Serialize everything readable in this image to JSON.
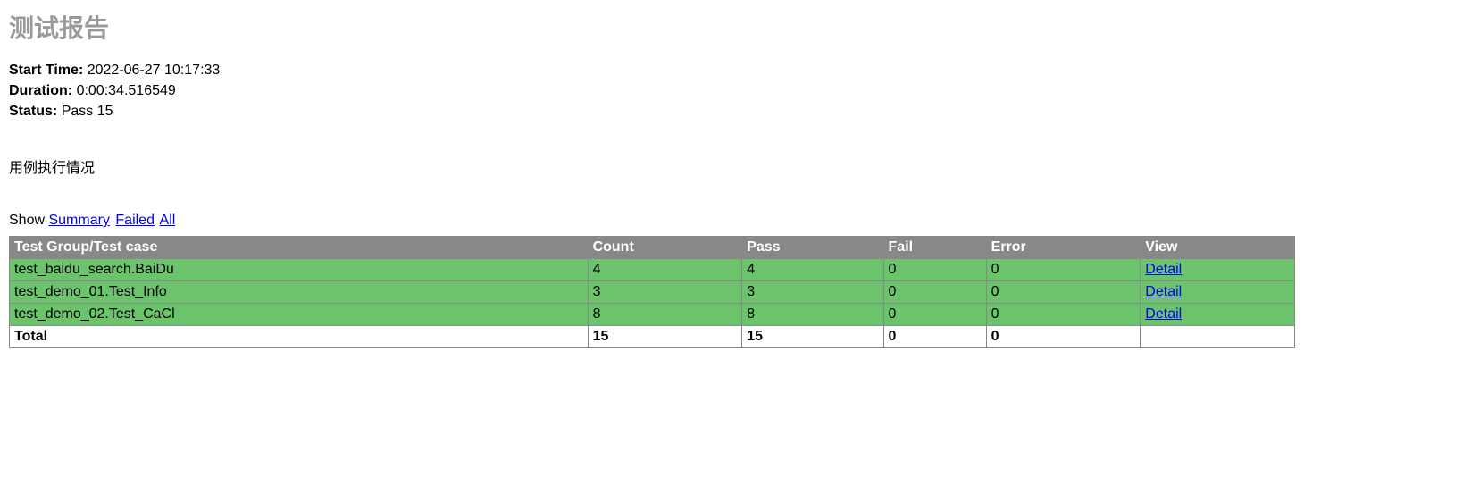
{
  "title": "测试报告",
  "info": {
    "start_time_label": "Start Time:",
    "start_time_value": "2022-06-27 10:17:33",
    "duration_label": "Duration:",
    "duration_value": "0:00:34.516549",
    "status_label": "Status:",
    "status_value": "Pass 15"
  },
  "section_title": "用例执行情况",
  "show": {
    "label": "Show",
    "summary": "Summary",
    "failed": "Failed",
    "all": "All"
  },
  "table": {
    "headers": {
      "name": "Test Group/Test case",
      "count": "Count",
      "pass": "Pass",
      "fail": "Fail",
      "error": "Error",
      "view": "View"
    },
    "rows": [
      {
        "name": "test_baidu_search.BaiDu",
        "count": "4",
        "pass": "4",
        "fail": "0",
        "error": "0",
        "view": "Detail"
      },
      {
        "name": "test_demo_01.Test_Info",
        "count": "3",
        "pass": "3",
        "fail": "0",
        "error": "0",
        "view": "Detail"
      },
      {
        "name": "test_demo_02.Test_CaCl",
        "count": "8",
        "pass": "8",
        "fail": "0",
        "error": "0",
        "view": "Detail"
      }
    ],
    "total": {
      "name": "Total",
      "count": "15",
      "pass": "15",
      "fail": "0",
      "error": "0",
      "view": ""
    }
  }
}
